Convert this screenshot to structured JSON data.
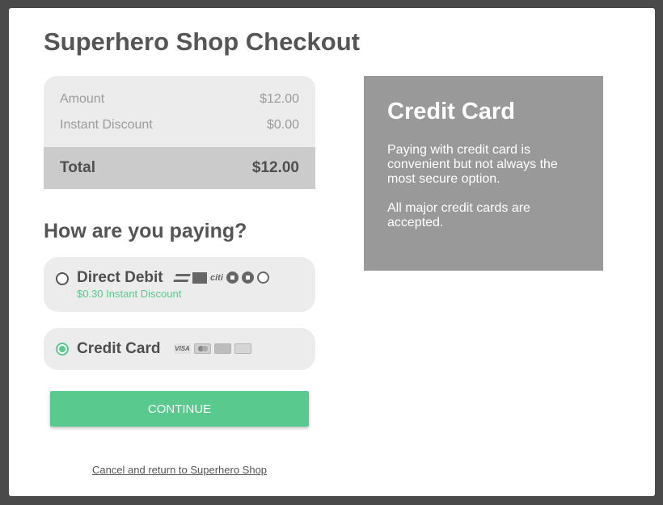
{
  "checkout": {
    "title": "Superhero Shop Checkout",
    "summary": {
      "amount_label": "Amount",
      "amount_value": "$12.00",
      "discount_label": "Instant Discount",
      "discount_value": "$0.00",
      "total_label": "Total",
      "total_value": "$12.00"
    },
    "question": "How are you paying?",
    "options": [
      {
        "label": "Direct Debit",
        "sub": "$0.30 Instant Discount",
        "selected": false,
        "logos": [
          "bank-wave-icon",
          "bank-logo-icon",
          "citi-logo-icon",
          "chase-logo-icon",
          "usbank-logo-icon",
          "bank-arrow-icon"
        ]
      },
      {
        "label": "Credit Card",
        "selected": true,
        "logos": [
          "visa-icon",
          "mastercard-icon",
          "amex-icon",
          "discover-icon"
        ]
      }
    ],
    "citi_text": "citi",
    "visa_text": "VISA",
    "continue_label": "CONTINUE",
    "cancel_label": "Cancel and return to Superhero Shop",
    "accent_color": "#5ac98e"
  },
  "info_panel": {
    "title": "Credit Card",
    "paragraph1": "Paying with credit card is convenient but not always the most secure option.",
    "paragraph2": "All major credit cards are accepted.",
    "background": "#999999"
  }
}
